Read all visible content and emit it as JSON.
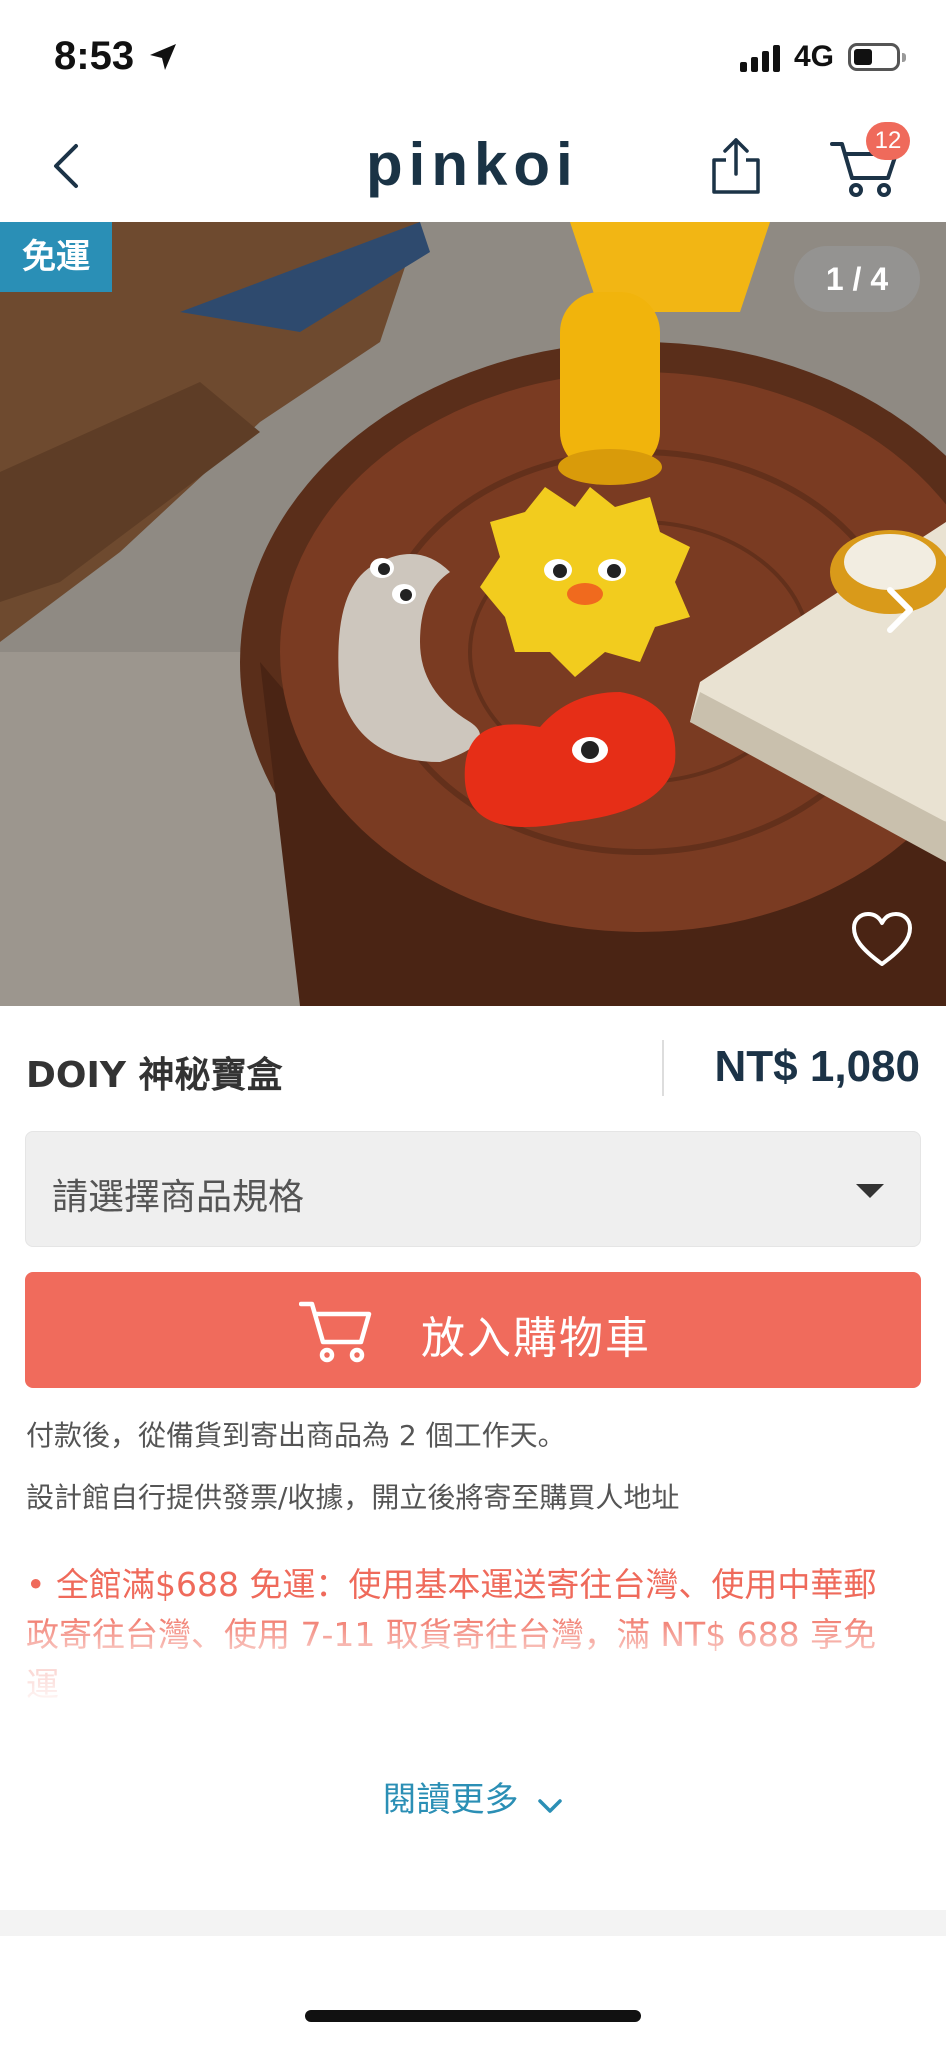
{
  "status_bar": {
    "time": "8:53",
    "network": "4G"
  },
  "nav": {
    "logo": "pinkoi",
    "cart_count": "12"
  },
  "gallery": {
    "free_shipping_tag": "免運",
    "counter": "1 / 4",
    "current_image": 1,
    "total_images": 4
  },
  "product": {
    "title": "DOIY 神秘寶盒",
    "price": "NT$ 1,080"
  },
  "spec_select": {
    "placeholder": "請選擇商品規格"
  },
  "cart_button": {
    "label": "放入購物車"
  },
  "info": {
    "shipping_time": "付款後，從備貨到寄出商品為 2 個工作天。",
    "invoice": "設計館自行提供發票/收據，開立後將寄至購買人地址"
  },
  "promo": {
    "text": "• 全館滿$688 免運：使用基本運送寄往台灣、使用中華郵政寄往台灣、使用 7-11 取貨寄往台灣，滿 NT$ 688 享免運"
  },
  "read_more": {
    "label": "閱讀更多"
  },
  "colors": {
    "accent": "#f06b5c",
    "brand_blue": "#2a8fb6",
    "price_navy": "#1c3347"
  }
}
